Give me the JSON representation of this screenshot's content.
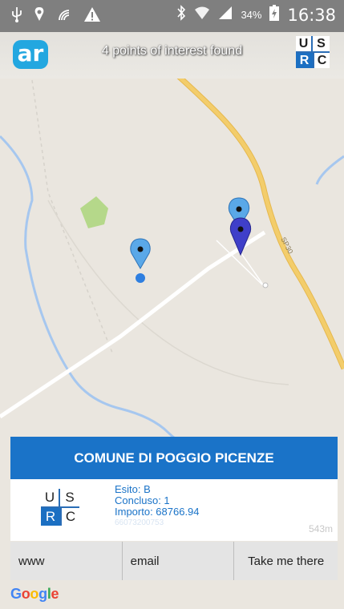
{
  "status_bar": {
    "time": "16:38",
    "battery": "34%",
    "icons": [
      "usb-icon",
      "location-icon",
      "nfc-icon",
      "warning-icon",
      "bluetooth-icon",
      "wifi-icon",
      "signal-icon",
      "battery-icon"
    ]
  },
  "header": {
    "app_logo": "ar",
    "poi_count": "4 points of interest found",
    "brand": {
      "u": "U",
      "s": "S",
      "r": "R",
      "c": "C"
    }
  },
  "map": {
    "road_label": "SP30",
    "colors": {
      "road_major": "#f3cd6b",
      "road_minor": "#ffffff",
      "river": "#a6c7ef",
      "park": "#b5d88a",
      "pin_light": "#5aa8e8",
      "pin_selected": "#3f3fc9",
      "user_dot": "#2f7fe0"
    }
  },
  "card": {
    "title": "COMUNE DI POGGIO PICENZE",
    "logo": {
      "u": "U",
      "s": "S",
      "r": "R",
      "c": "C"
    },
    "esito": "Esito: B",
    "concluso": "Concluso: 1",
    "importo": "Importo:   68766.94",
    "code": "66073200753",
    "distance": "543m",
    "buttons": {
      "www": "www",
      "email": "email",
      "navigate": "Take me there"
    }
  },
  "footer": {
    "google_letters": [
      "G",
      "o",
      "o",
      "g",
      "l",
      "e"
    ],
    "google_colors": [
      "#4285f4",
      "#ea4335",
      "#fbbc05",
      "#4285f4",
      "#34a853",
      "#ea4335"
    ]
  }
}
